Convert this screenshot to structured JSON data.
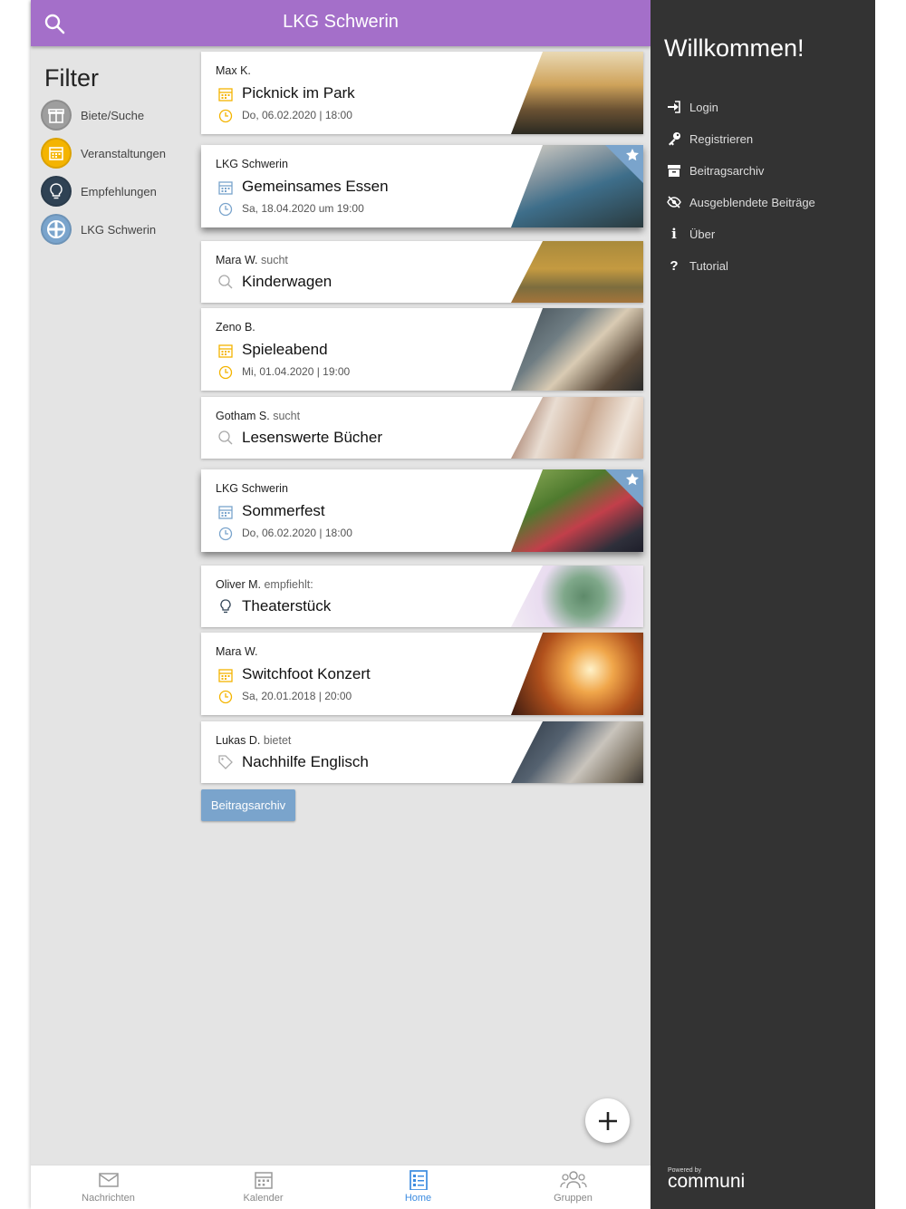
{
  "header": {
    "title": "LKG Schwerin"
  },
  "filter": {
    "heading": "Filter",
    "items": [
      {
        "label": "Biete/Suche",
        "color": "#9e9e9e"
      },
      {
        "label": "Veranstaltungen",
        "color": "#f4b400"
      },
      {
        "label": "Empfehlungen",
        "color": "#2f4254"
      },
      {
        "label": "LKG Schwerin",
        "color": "#7aa4cc"
      }
    ]
  },
  "feed": [
    {
      "author": "Max K.",
      "verb": "",
      "title": "Picknick im Park",
      "date": "Do, 06.02.2020 | 18:00",
      "type": "event",
      "featured": false
    },
    {
      "author": "LKG Schwerin",
      "verb": "",
      "title": "Gemeinsames Essen",
      "date": "Sa, 18.04.2020 um 19:00",
      "type": "group",
      "featured": true
    },
    {
      "author": "Mara W.",
      "verb": "sucht",
      "title": "Kinderwagen",
      "date": "",
      "type": "search",
      "featured": false
    },
    {
      "author": "Zeno B.",
      "verb": "",
      "title": "Spieleabend",
      "date": "Mi, 01.04.2020 | 19:00",
      "type": "event",
      "featured": false
    },
    {
      "author": "Gotham S.",
      "verb": "sucht",
      "title": "Lesenswerte Bücher",
      "date": "",
      "type": "search",
      "featured": false
    },
    {
      "author": "LKG Schwerin",
      "verb": "",
      "title": "Sommerfest",
      "date": "Do, 06.02.2020 | 18:00",
      "type": "group",
      "featured": true
    },
    {
      "author": "Oliver M.",
      "verb": "empfiehlt:",
      "title": "Theaterstück",
      "date": "",
      "type": "recommend",
      "featured": false
    },
    {
      "author": "Mara W.",
      "verb": "",
      "title": "Switchfoot Konzert",
      "date": "Sa, 20.01.2018 | 20:00",
      "type": "event",
      "featured": false
    },
    {
      "author": "Lukas D.",
      "verb": "bietet",
      "title": "Nachhilfe Englisch",
      "date": "",
      "type": "offer",
      "featured": false
    }
  ],
  "archive_button": "Beitragsarchiv",
  "tabs": [
    {
      "label": "Nachrichten",
      "icon": "mail-icon",
      "active": false
    },
    {
      "label": "Kalender",
      "icon": "calendar-icon",
      "active": false
    },
    {
      "label": "Home",
      "icon": "list-icon",
      "active": true
    },
    {
      "label": "Gruppen",
      "icon": "people-icon",
      "active": false
    }
  ],
  "sidebar": {
    "welcome": "Willkommen!",
    "items": [
      {
        "label": "Login",
        "icon": "login-icon"
      },
      {
        "label": "Registrieren",
        "icon": "key-icon"
      },
      {
        "label": "Beitragsarchiv",
        "icon": "archive-icon"
      },
      {
        "label": "Ausgeblendete Beiträge",
        "icon": "eye-slash-icon"
      },
      {
        "label": "Über",
        "icon": "info-icon"
      },
      {
        "label": "Tutorial",
        "icon": "question-icon"
      }
    ],
    "powered_by": "Powered by",
    "brand": "communi"
  },
  "colors": {
    "header": "#a46fc9",
    "accent": "#7aa4cc",
    "event": "#f4b400",
    "sidebar": "#333333",
    "active_tab": "#3b8be0"
  }
}
